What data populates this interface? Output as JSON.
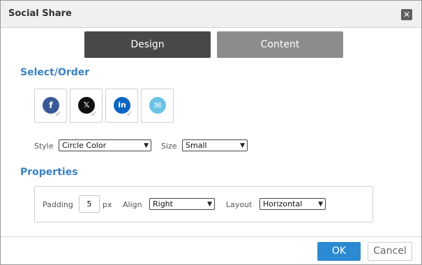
{
  "dialog": {
    "title": "Social Share",
    "close_glyph": "✕"
  },
  "tabs": [
    {
      "label": "Design",
      "active": true
    },
    {
      "label": "Content",
      "active": false
    }
  ],
  "select_order": {
    "heading": "Select/Order",
    "icons": [
      {
        "name": "facebook-icon",
        "glyph": "f",
        "color": "#3b5998",
        "checked": true
      },
      {
        "name": "x-icon",
        "glyph": "𝕏",
        "color": "#111111",
        "checked": true
      },
      {
        "name": "linkedin-icon",
        "glyph": "in",
        "color": "#0a66c2",
        "checked": true
      },
      {
        "name": "email-icon",
        "glyph": "✉",
        "color": "#6cc3e6",
        "checked": false
      }
    ],
    "style_label": "Style",
    "style_value": "Circle Color",
    "size_label": "Size",
    "size_value": "Small"
  },
  "properties": {
    "heading": "Properties",
    "padding_label": "Padding",
    "padding_value": "5",
    "padding_unit": "px",
    "align_label": "Align",
    "align_value": "Right",
    "layout_label": "Layout",
    "layout_value": "Horizontal"
  },
  "footer": {
    "ok_label": "OK",
    "cancel_label": "Cancel"
  },
  "colors": {
    "accent": "#3a82c4",
    "ok_button": "#2b8ad1",
    "tab_active": "#484848",
    "tab_inactive": "#8c8c8c"
  }
}
